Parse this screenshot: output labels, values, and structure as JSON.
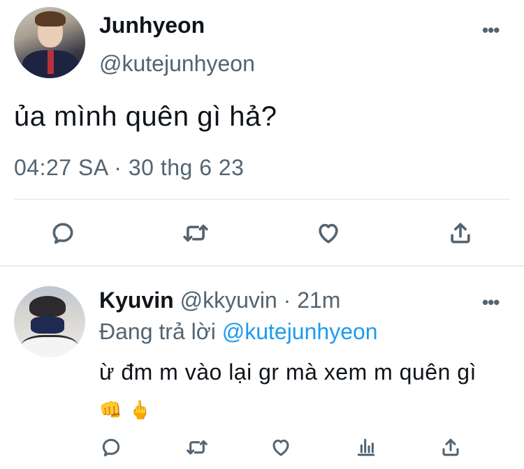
{
  "main_tweet": {
    "display_name": "Junhyeon",
    "handle": "@kutejunhyeon",
    "more_label": "•••",
    "text": "ủa mình quên gì hả?",
    "timestamp": "04:27 SA · 30 thg 6 23",
    "actions": [
      "reply-icon",
      "retweet-icon",
      "like-icon",
      "share-icon"
    ]
  },
  "reply_tweet": {
    "display_name": "Kyuvin",
    "handle": "@kkyuvin",
    "time": " · 21m",
    "more_label": "•••",
    "replying_prefix": "Đang trả lời ",
    "replying_mention": "@kutejunhyeon",
    "text": "ừ đm m vào lại gr mà xem m quên gì",
    "emoji_1": "👊",
    "emoji_2": "🖕",
    "actions": [
      "reply-icon",
      "retweet-icon",
      "like-icon",
      "views-icon",
      "share-icon"
    ]
  },
  "colors": {
    "text": "#0f1419",
    "secondary": "#536471",
    "link": "#1d9bf0",
    "divider": "#e7e9eb"
  }
}
